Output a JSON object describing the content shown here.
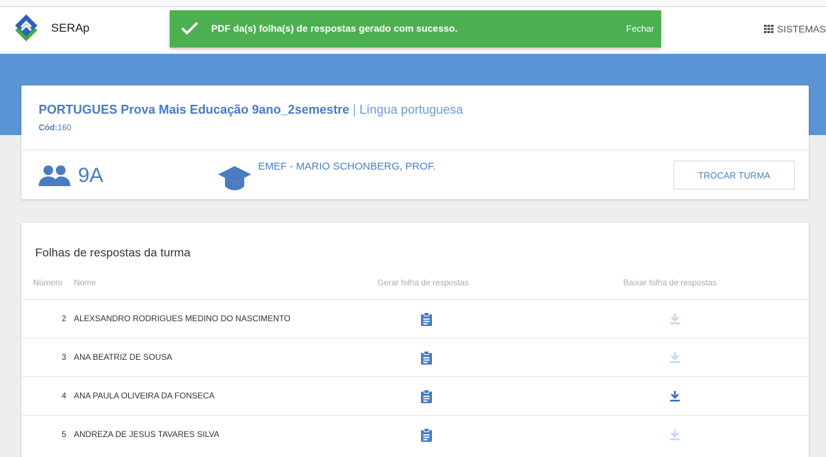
{
  "header": {
    "brand": "SERAp",
    "sistemas_label": "SISTEMAS"
  },
  "toast": {
    "message": "PDF da(s) folha(s) de respostas gerado com sucesso.",
    "close_label": "Fechar"
  },
  "prova": {
    "title": "PORTUGUES Prova Mais Educação 9ano_2semestre",
    "separator": "|",
    "subject": "Língua portuguesa",
    "cod_label": "Cód:",
    "cod_value": "160",
    "turma": "9A",
    "escola": "EMEF - MARIO SCHONBERG, PROF.",
    "trocar_label": "TROCAR TURMA"
  },
  "folhas": {
    "title": "Folhas de respostas da turma",
    "columns": {
      "numero": "Número",
      "nome": "Nome",
      "gerar": "Gerar folha de respostas",
      "baixar": "Baixar folha de respostas"
    },
    "rows": [
      {
        "numero": "2",
        "nome": "ALEXSANDRO RODRIGUES MEDINO DO NASCIMENTO",
        "download_enabled": false
      },
      {
        "numero": "3",
        "nome": "ANA BEATRIZ DE SOUSA",
        "download_enabled": false
      },
      {
        "numero": "4",
        "nome": "ANA PAULA OLIVEIRA DA FONSECA",
        "download_enabled": true
      },
      {
        "numero": "5",
        "nome": "ANDREZA DE JESUS TAVARES SILVA",
        "download_enabled": false
      }
    ]
  },
  "colors": {
    "primary": "#4a7cc2",
    "band": "#5a94d6",
    "toast": "#4caf50",
    "download_disabled": "#c4d6ef"
  }
}
